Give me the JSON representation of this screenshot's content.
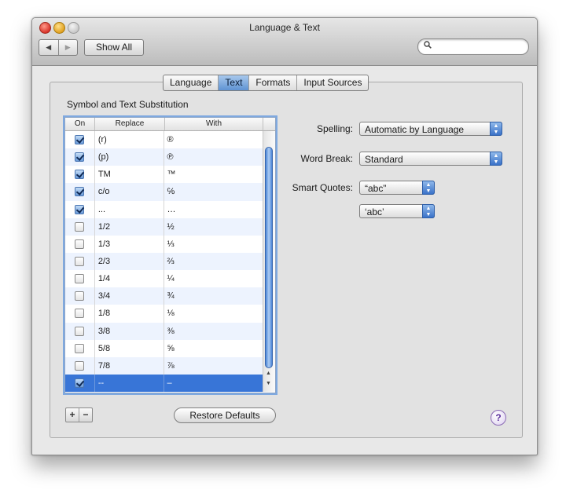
{
  "window": {
    "title": "Language & Text"
  },
  "toolbar": {
    "back_glyph": "◀",
    "forward_glyph": "▶",
    "show_all_label": "Show All",
    "search_value": "",
    "search_icon": "magnifier-icon"
  },
  "tabs": [
    {
      "label": "Language",
      "active": false
    },
    {
      "label": "Text",
      "active": true
    },
    {
      "label": "Formats",
      "active": false
    },
    {
      "label": "Input Sources",
      "active": false
    }
  ],
  "substitution": {
    "section_title": "Symbol and Text Substitution",
    "columns": {
      "on": "On",
      "replace": "Replace",
      "with": "With"
    },
    "rows": [
      {
        "on": true,
        "replace": "(r)",
        "with": "®"
      },
      {
        "on": true,
        "replace": "(p)",
        "with": "℗"
      },
      {
        "on": true,
        "replace": "TM",
        "with": "™"
      },
      {
        "on": true,
        "replace": "c/o",
        "with": "℅"
      },
      {
        "on": true,
        "replace": "...",
        "with": "…"
      },
      {
        "on": false,
        "replace": "1/2",
        "with": "½"
      },
      {
        "on": false,
        "replace": "1/3",
        "with": "⅓"
      },
      {
        "on": false,
        "replace": "2/3",
        "with": "⅔"
      },
      {
        "on": false,
        "replace": "1/4",
        "with": "¼"
      },
      {
        "on": false,
        "replace": "3/4",
        "with": "¾"
      },
      {
        "on": false,
        "replace": "1/8",
        "with": "⅛"
      },
      {
        "on": false,
        "replace": "3/8",
        "with": "⅜"
      },
      {
        "on": false,
        "replace": "5/8",
        "with": "⅝"
      },
      {
        "on": false,
        "replace": "7/8",
        "with": "⅞"
      },
      {
        "on": true,
        "replace": "--",
        "with": "–",
        "selected": true
      }
    ],
    "add_label": "+",
    "remove_label": "−",
    "restore_label": "Restore Defaults"
  },
  "settings": {
    "spelling_label": "Spelling:",
    "spelling_value": "Automatic by Language",
    "word_break_label": "Word Break:",
    "word_break_value": "Standard",
    "smart_quotes_label": "Smart Quotes:",
    "double_quotes_value": "“abc”",
    "single_quotes_value": "‘abc’"
  },
  "help_label": "?",
  "colors": {
    "selection": "#3875d7",
    "accent": "#5f93d3"
  }
}
